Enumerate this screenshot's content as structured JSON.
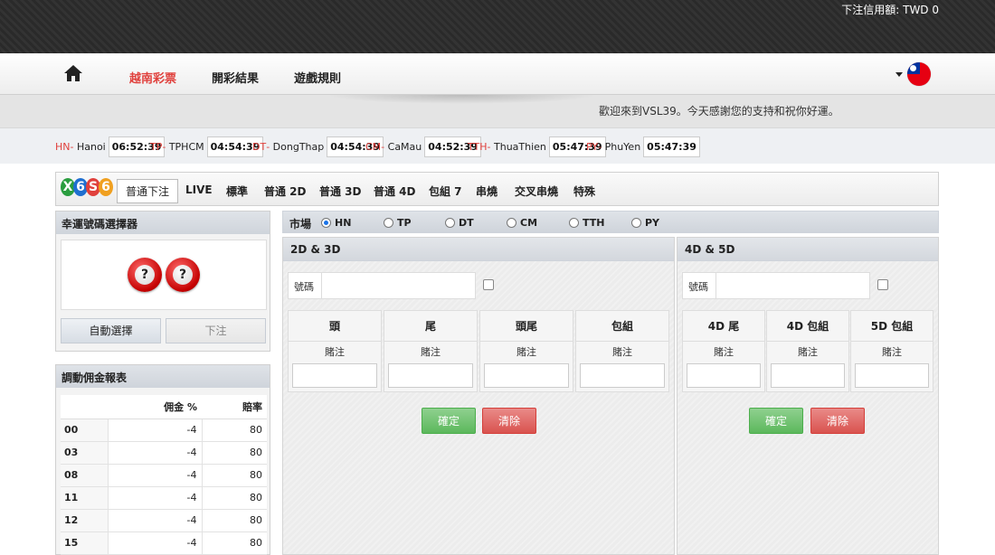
{
  "topbar": {
    "credit": "下注信用額: TWD 0"
  },
  "nav": {
    "links": [
      "越南彩票",
      "開彩結果",
      "遊戲規則"
    ]
  },
  "welcome": "歡迎來到VSL39。今天感謝您的支持和祝你好運。",
  "timers": [
    {
      "code": "HN",
      "loc": "Hanoi",
      "time": "06:52:39"
    },
    {
      "code": "TP",
      "loc": "TPHCM",
      "time": "04:54:39"
    },
    {
      "code": "DT",
      "loc": "DongThap",
      "time": "04:54:39"
    },
    {
      "code": "CM",
      "loc": "CaMau",
      "time": "04:52:39"
    },
    {
      "code": "TTH",
      "loc": "ThuaThien",
      "time": "05:47:39"
    },
    {
      "code": "PY",
      "loc": "PhuYen",
      "time": "05:47:39"
    }
  ],
  "logo": [
    "X",
    "6",
    "S",
    "6"
  ],
  "tabs": [
    "普通下注",
    "LIVE",
    "標準",
    "普通 2D",
    "普通 3D",
    "普通 4D",
    "包組 7",
    "串燒",
    "交叉串燒",
    "特殊"
  ],
  "picker": {
    "title": "幸運號碼選擇器",
    "ball": "?",
    "auto": "自動選擇",
    "bet": "下注"
  },
  "commission": {
    "title": "調動佣金報表",
    "headers": [
      "",
      "佣金 %",
      "賠率"
    ],
    "rows": [
      [
        "00",
        "-4",
        "80"
      ],
      [
        "03",
        "-4",
        "80"
      ],
      [
        "08",
        "-4",
        "80"
      ],
      [
        "11",
        "-4",
        "80"
      ],
      [
        "12",
        "-4",
        "80"
      ],
      [
        "15",
        "-4",
        "80"
      ]
    ]
  },
  "market": {
    "label": "市場",
    "options": [
      "HN",
      "TP",
      "DT",
      "CM",
      "TTH",
      "PY"
    ],
    "selected": "HN"
  },
  "sec2d": {
    "title": "2D & 3D",
    "num_label": "號碼",
    "cols": [
      "頭",
      "尾",
      "頭尾",
      "包組"
    ],
    "sub": "賭注",
    "confirm": "確定",
    "clear": "清除"
  },
  "sec4d": {
    "title": "4D & 5D",
    "num_label": "號碼",
    "cols": [
      "4D 尾",
      "4D 包組",
      "5D 包組"
    ],
    "sub": "賭注",
    "confirm": "確定",
    "clear": "清除"
  },
  "colors": {
    "accent": "#e0403c",
    "green": "#5cb85c",
    "red": "#d9534f"
  }
}
